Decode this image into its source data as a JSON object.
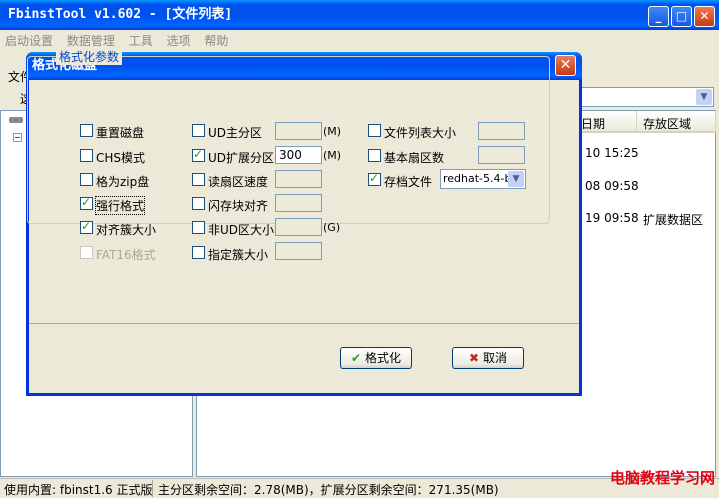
{
  "main_window": {
    "title": "FbinstTool v1.602 - [文件列表]",
    "min_btn": "_",
    "max_btn": "□",
    "close_btn": "✕"
  },
  "menu": [
    "启动设置",
    "数据管理",
    "工具",
    "选项",
    "帮助"
  ],
  "toolbar": {
    "partial_label_1": "文件",
    "partial_label_2": "这"
  },
  "list": {
    "col_date": "日期",
    "col_area": "存放区域",
    "rows": [
      {
        "date": "10 15:25",
        "area": ""
      },
      {
        "date": "08 09:58",
        "area": ""
      },
      {
        "date": "19 09:58",
        "area": "扩展数据区"
      }
    ]
  },
  "status": {
    "built_in": "使用内置: fbinst1.6 正式版",
    "space": "主分区剩余空间：2.78(MB)，扩展分区剩余空间：271.35(MB)"
  },
  "watermark": "电脑教程学习网",
  "dialog": {
    "title": "格式化磁盘",
    "close": "✕",
    "group_title": "格式化参数",
    "col1": [
      {
        "label": "重置磁盘",
        "checked": false
      },
      {
        "label": "CHS模式",
        "checked": false
      },
      {
        "label": "格为zip盘",
        "checked": false
      },
      {
        "label": "强行格式",
        "checked": true
      },
      {
        "label": "对齐簇大小",
        "checked": true
      },
      {
        "label": "FAT16格式",
        "checked": false
      }
    ],
    "col2": [
      {
        "label": "UD主分区",
        "checked": false,
        "value": "",
        "unit": "(M)"
      },
      {
        "label": "UD扩展分区",
        "checked": true,
        "value": "300",
        "unit": "(M)"
      },
      {
        "label": "读扇区速度",
        "checked": false,
        "value": "",
        "unit": ""
      },
      {
        "label": "闪存块对齐",
        "checked": false,
        "value": "",
        "unit": ""
      },
      {
        "label": "非UD区大小",
        "checked": false,
        "value": "",
        "unit": "(G)"
      },
      {
        "label": "指定簇大小",
        "checked": false,
        "value": "",
        "unit": ""
      }
    ],
    "col3": [
      {
        "label": "文件列表大小",
        "checked": false,
        "value": ""
      },
      {
        "label": "基本扇区数",
        "checked": false,
        "value": ""
      },
      {
        "label": "存档文件",
        "checked": true,
        "value": "redhat-5.4-b"
      }
    ],
    "format_btn": "格式化",
    "format_icon": "✔",
    "cancel_btn": "取消",
    "cancel_icon": "✖"
  }
}
